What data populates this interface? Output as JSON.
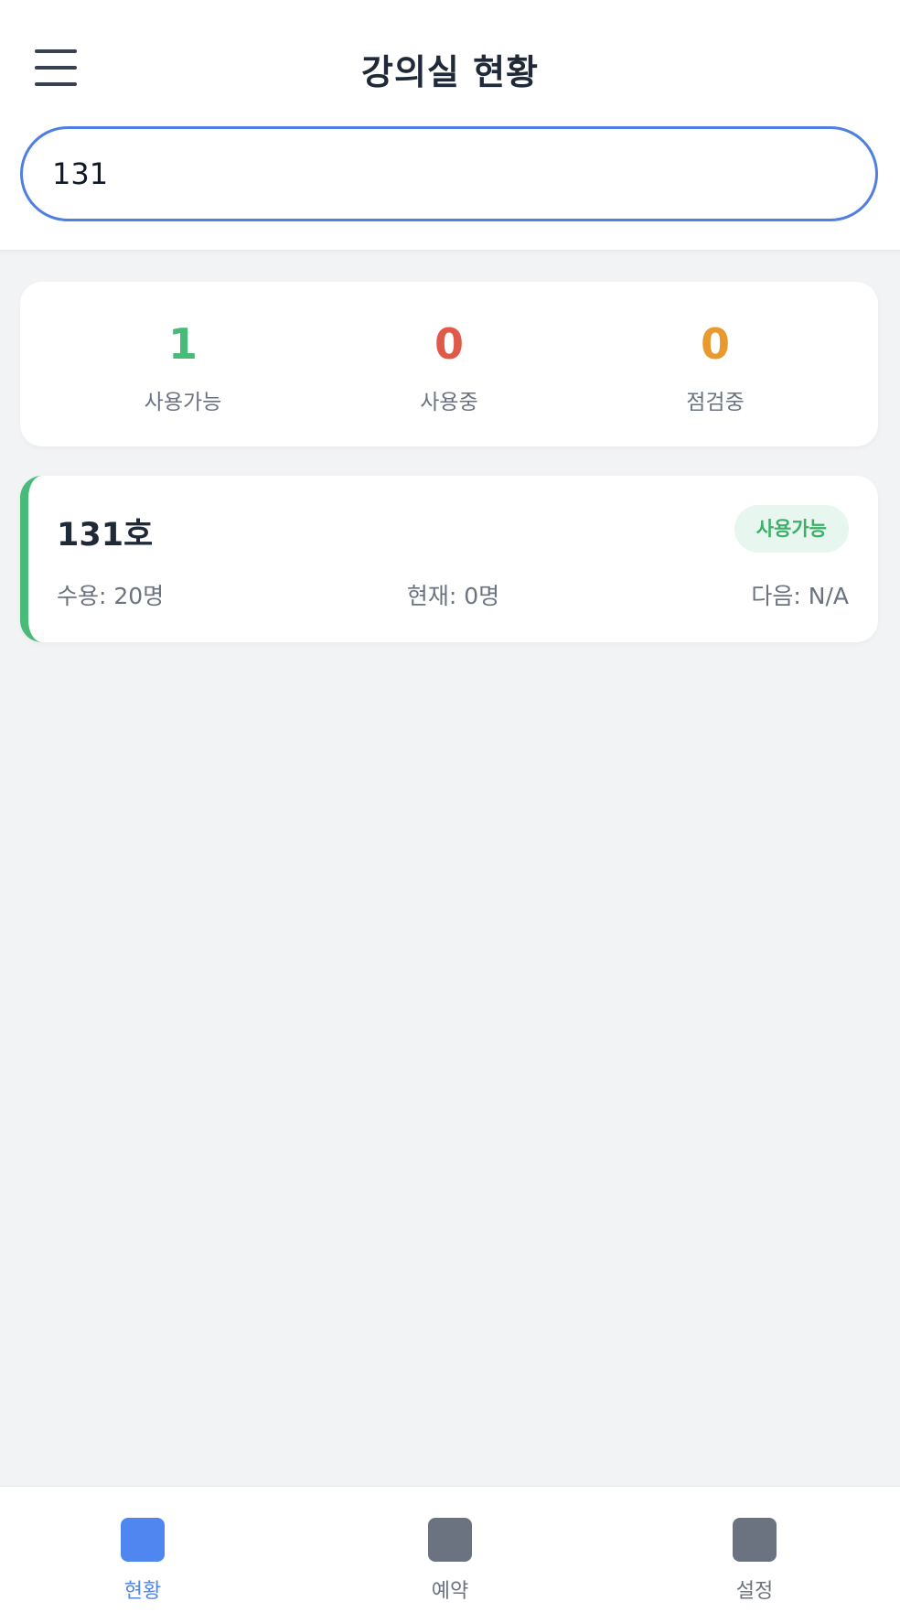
{
  "header": {
    "title": "강의실 현황",
    "menu_icon": "hamburger-icon"
  },
  "search": {
    "value": "131",
    "placeholder": ""
  },
  "stats": {
    "available": {
      "value": "1",
      "label": "사용가능",
      "color": "#48bb78"
    },
    "in_use": {
      "value": "0",
      "label": "사용중",
      "color": "#e05a4a"
    },
    "maintenance": {
      "value": "0",
      "label": "점검중",
      "color": "#e99a2f"
    }
  },
  "rooms": [
    {
      "name": "131호",
      "status": "사용가능",
      "status_color": "#48bb78",
      "capacity": "수용: 20명",
      "current": "현재: 0명",
      "next": "다음: N/A"
    }
  ],
  "nav": {
    "items": [
      {
        "label": "현황",
        "icon": "status-icon",
        "active": true,
        "color": "#4f86f0"
      },
      {
        "label": "예약",
        "icon": "reservation-icon",
        "active": false,
        "color": "#6b7280"
      },
      {
        "label": "설정",
        "icon": "settings-icon",
        "active": false,
        "color": "#6b7280"
      }
    ]
  }
}
